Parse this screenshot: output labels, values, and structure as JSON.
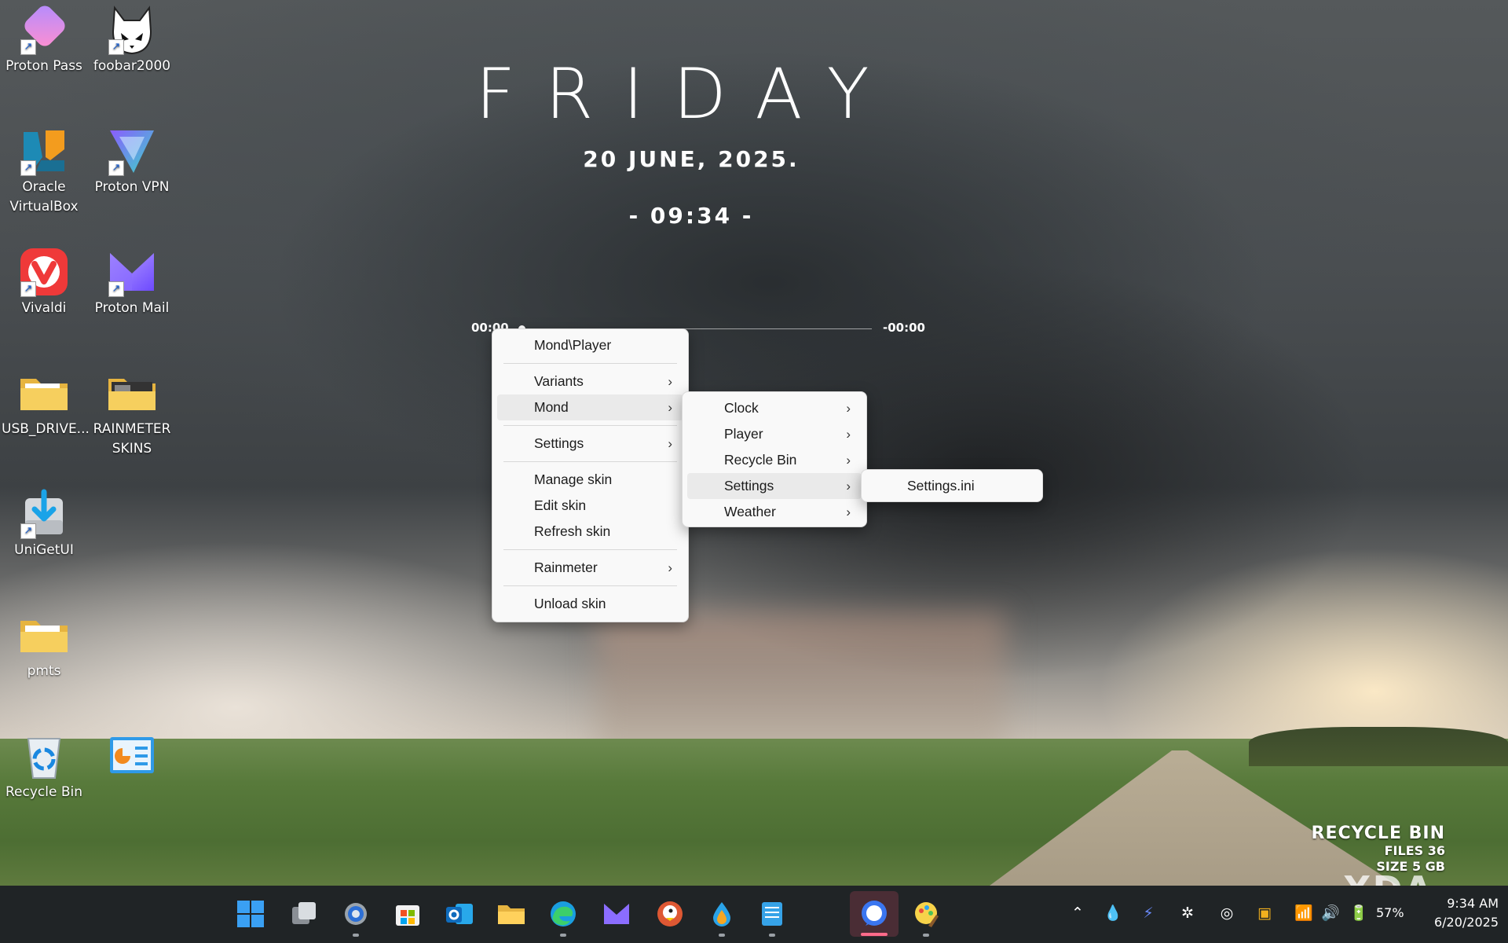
{
  "widget": {
    "day": "FRIDAY",
    "date": "20 JUNE, 2025.",
    "time": "- 09:34 -",
    "player_elapsed": "00:00",
    "player_remaining": "-00:00"
  },
  "desktop_icons": [
    {
      "label": "Proton Pass",
      "icon": "proton-pass-icon"
    },
    {
      "label": "foobar2000",
      "icon": "foobar2000-icon"
    },
    {
      "label": "Oracle VirtualBox",
      "icon": "virtualbox-icon"
    },
    {
      "label": "Proton VPN",
      "icon": "proton-vpn-icon"
    },
    {
      "label": "Vivaldi",
      "icon": "vivaldi-icon"
    },
    {
      "label": "Proton Mail",
      "icon": "proton-mail-icon"
    },
    {
      "label": "USB_DRIVE...",
      "icon": "folder-icon"
    },
    {
      "label": "RAINMETER SKINS",
      "icon": "folder-icon"
    },
    {
      "label": "UniGetUI",
      "icon": "unigetui-icon"
    },
    {
      "label": "pmts",
      "icon": "folder-icon"
    },
    {
      "label": "Recycle Bin",
      "icon": "recycle-bin-icon"
    },
    {
      "label": "",
      "icon": "control-panel-icon"
    }
  ],
  "menu_main": {
    "title": "Mond\\Player",
    "variants": "Variants",
    "mond": "Mond",
    "settings": "Settings",
    "manage_skin": "Manage skin",
    "edit_skin": "Edit skin",
    "refresh_skin": "Refresh skin",
    "rainmeter": "Rainmeter",
    "unload_skin": "Unload skin"
  },
  "menu_mond": {
    "clock": "Clock",
    "player": "Player",
    "recycle_bin": "Recycle Bin",
    "settings": "Settings",
    "weather": "Weather"
  },
  "menu_settings": {
    "settings_ini": "Settings.ini"
  },
  "recycle_widget": {
    "title": "RECYCLE BIN",
    "files": "FILES 36",
    "size": "SIZE 5 GB"
  },
  "watermark": "XDA",
  "taskbar": {
    "icons": [
      "start-icon",
      "task-view-icon",
      "settings-icon",
      "store-icon",
      "outlook-icon",
      "file-explorer-icon",
      "edge-icon",
      "proton-mail-icon",
      "duckduckgo-icon",
      "drop-icon",
      "notepad-icon",
      "signal-icon",
      "paint-icon"
    ],
    "battery": "57%",
    "time": "9:34 AM",
    "date": "6/20/2025"
  },
  "colors": {
    "menu_bg": "#f9f9f9",
    "menu_active": "#eaeaea",
    "taskbar": "#202426"
  }
}
